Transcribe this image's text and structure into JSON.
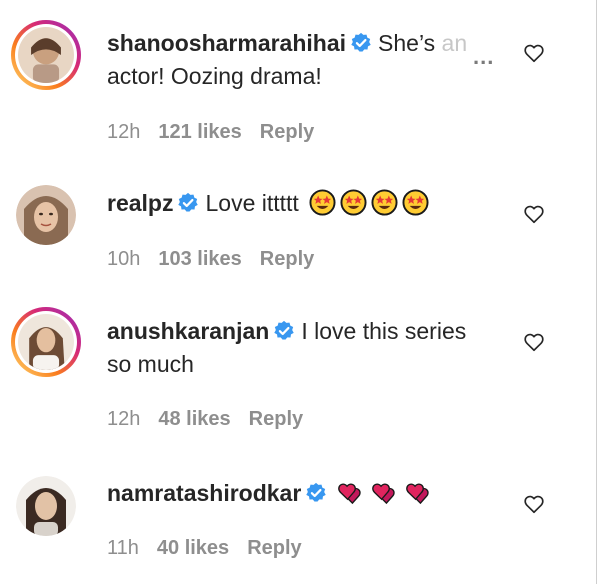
{
  "comments": [
    {
      "username": "shanoosharmarahihai",
      "text_visible": "She’s ",
      "text_faded": "an",
      "text_line2": "actor! Oozing drama!",
      "more_label": "...",
      "time": "12h",
      "likes": "121 likes",
      "reply": "Reply",
      "avatar_icon": "avatar-photo",
      "has_story_ring": true
    },
    {
      "username": "realpz",
      "text": "Love ittttt",
      "emoji": [
        "star-struck",
        "star-struck",
        "star-struck",
        "star-struck"
      ],
      "time": "10h",
      "likes": "103 likes",
      "reply": "Reply",
      "avatar_icon": "avatar-photo",
      "has_story_ring": false
    },
    {
      "username": "anushkaranjan",
      "text": "I love this series",
      "text_line2": "so much",
      "time": "12h",
      "likes": "48 likes",
      "reply": "Reply",
      "avatar_icon": "avatar-photo",
      "has_story_ring": true
    },
    {
      "username": "namratashirodkar",
      "emoji": [
        "two-hearts",
        "two-hearts",
        "two-hearts"
      ],
      "time": "11h",
      "likes": "40 likes",
      "reply": "Reply",
      "avatar_icon": "avatar-photo",
      "has_story_ring": false
    }
  ],
  "colors": {
    "verified_badge": "#3897f0",
    "meta_text": "#8e8e8e",
    "primary_text": "#262626",
    "heart_emoji": "#e0245e",
    "star_emoji_face": "#ffcc33"
  },
  "icons": {
    "verified": "verified-badge-icon",
    "like": "heart-outline-icon",
    "more": "more-options-icon"
  }
}
